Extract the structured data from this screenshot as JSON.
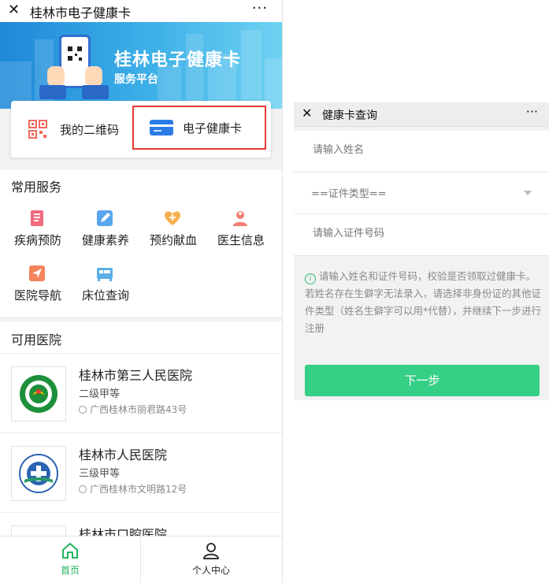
{
  "left_window": {
    "title": "桂林市电子健康卡",
    "close_icon": "close-icon",
    "more_label": "···",
    "banner": {
      "title": "桂林电子健康卡",
      "subtitle": "服务平台"
    },
    "card_actions": {
      "my_qr": "我的二维码",
      "e_card": "电子健康卡"
    },
    "services": {
      "title": "常用服务",
      "items": [
        {
          "label": "疾病预防",
          "icon": "notebook-icon",
          "color": "#f06a7f"
        },
        {
          "label": "健康素养",
          "icon": "edit-icon",
          "color": "#5aa6ee"
        },
        {
          "label": "预约献血",
          "icon": "heart-plus-icon",
          "color": "#f6b152"
        },
        {
          "label": "医生信息",
          "icon": "nurse-icon",
          "color": "#f07e72"
        },
        {
          "label": "医院导航",
          "icon": "navigation-icon",
          "color": "#f5835c"
        },
        {
          "label": "床位查询",
          "icon": "bed-icon",
          "color": "#5aaee8"
        }
      ]
    },
    "hospitals": {
      "title": "可用医院",
      "items": [
        {
          "name": "桂林市第三人民医院",
          "level": "二级甲等",
          "address": "广西桂林市丽君路43号"
        },
        {
          "name": "桂林市人民医院",
          "level": "三级甲等",
          "address": "广西桂林市文明路12号"
        },
        {
          "name": "桂林市口腔医院",
          "level": "",
          "address": ""
        }
      ]
    },
    "tabbar": {
      "home": "首页",
      "personal": "个人中心",
      "active_color": "#22b35e"
    }
  },
  "right_window": {
    "title": "健康卡查询",
    "more_label": "···",
    "name_placeholder": "请输入姓名",
    "id_type_selected": "==证件类型==",
    "id_number_placeholder": "请输入证件号码",
    "tip_line1": "请输入姓名和证件号码，校验是否领取过健康卡。",
    "tip_line2": "若姓名存在生僻字无法录入，请选择非身份证的其他证件类型（姓名生僻字可以用*代替），并继续下一步进行注册",
    "next_button": "下一步",
    "accent": "#35cf86"
  }
}
